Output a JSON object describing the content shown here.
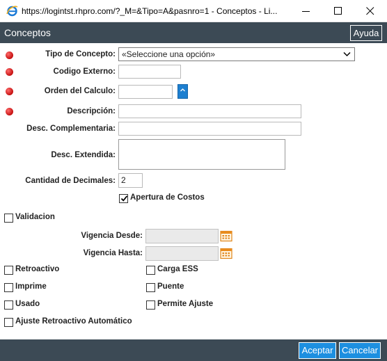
{
  "window": {
    "title": "https://logintst.rhpro.com/?_M=&Tipo=A&pasnro=1 - Conceptos - Li...",
    "icons": [
      "ie-icon",
      "minimize-icon",
      "maximize-icon",
      "close-icon"
    ]
  },
  "header": {
    "title": "Conceptos",
    "help_label": "Ayuda"
  },
  "form": {
    "tipo_concepto": {
      "label": "Tipo de Concepto:",
      "value": "«Seleccione una opción»"
    },
    "codigo_externo": {
      "label": "Codigo Externo:",
      "value": ""
    },
    "orden_calculo": {
      "label": "Orden del Calculo:",
      "value": ""
    },
    "descripcion": {
      "label": "Descripción:",
      "value": ""
    },
    "desc_complementaria": {
      "label": "Desc. Complementaria:",
      "value": ""
    },
    "desc_extendida": {
      "label": "Desc. Extendida:",
      "value": ""
    },
    "cantidad_decimales": {
      "label": "Cantidad de Decimales:",
      "value": "2"
    },
    "apertura_costos": {
      "label": "Apertura de Costos",
      "checked": true
    },
    "validacion": {
      "label": "Validacion",
      "checked": false
    },
    "vigencia_desde": {
      "label": "Vigencia Desde:",
      "value": ""
    },
    "vigencia_hasta": {
      "label": "Vigencia Hasta:",
      "value": ""
    },
    "retroactivo": {
      "label": "Retroactivo",
      "checked": false
    },
    "carga_ess": {
      "label": "Carga ESS",
      "checked": false
    },
    "imprime": {
      "label": "Imprime",
      "checked": false
    },
    "puente": {
      "label": "Puente",
      "checked": false
    },
    "usado": {
      "label": "Usado",
      "checked": false
    },
    "permite_ajuste": {
      "label": "Permite Ajuste",
      "checked": false
    },
    "ajuste_retroactivo": {
      "label": "Ajuste Retroactivo Automático",
      "checked": false
    }
  },
  "footer": {
    "accept_label": "Aceptar",
    "cancel_label": "Cancelar"
  },
  "colors": {
    "header_bg": "#3c4a55",
    "button_blue": "#1d8fe0",
    "required_dot": "#d41414"
  }
}
